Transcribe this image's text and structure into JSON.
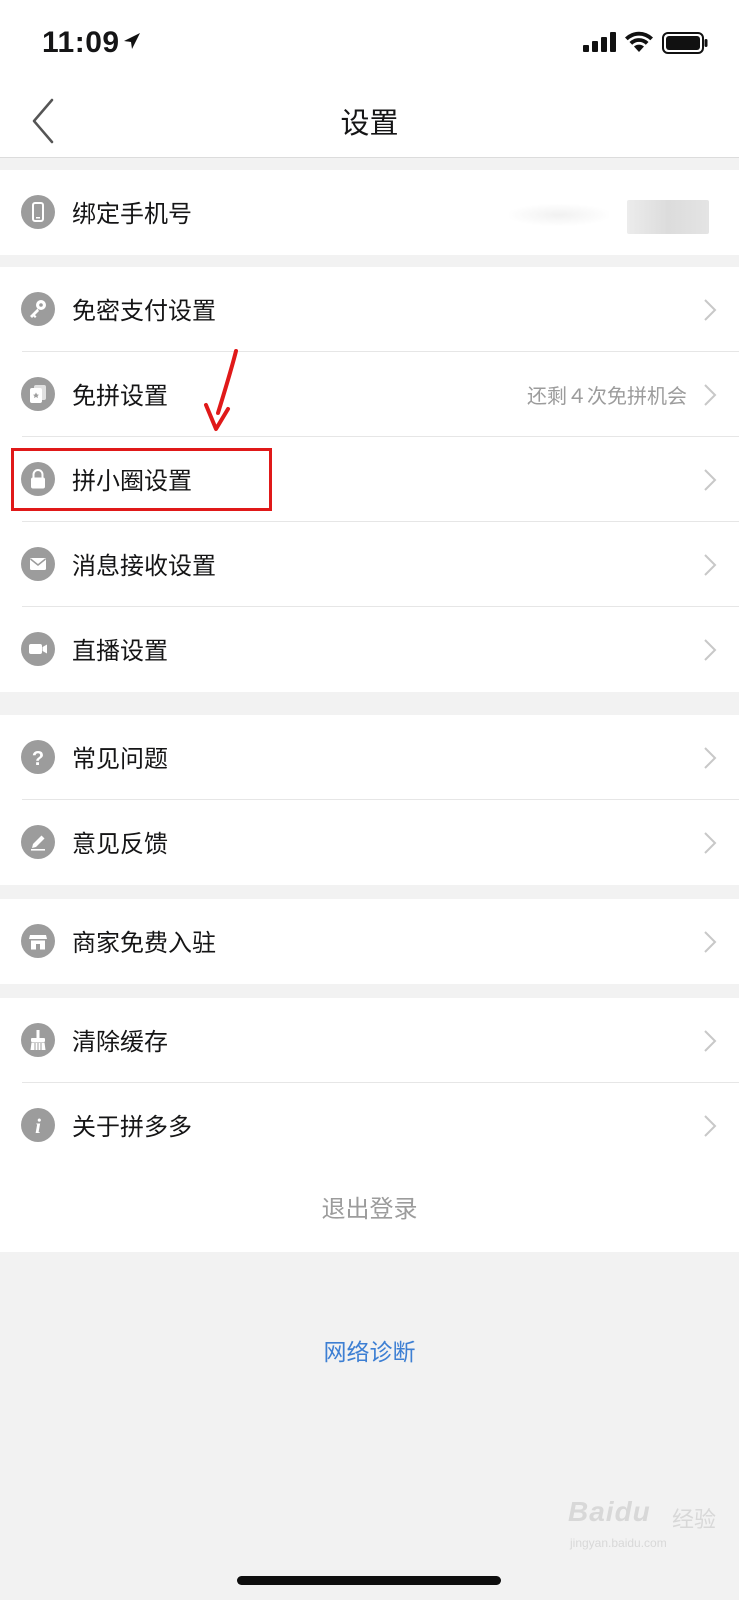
{
  "status_bar": {
    "time": "11:09"
  },
  "nav": {
    "title": "设置"
  },
  "groups": [
    {
      "items": [
        {
          "icon": "phone-icon",
          "label": "绑定手机号",
          "value": ""
        }
      ]
    },
    {
      "items": [
        {
          "icon": "key-icon",
          "label": "免密支付设置",
          "value": ""
        },
        {
          "icon": "cards-icon",
          "label": "免拼设置",
          "value": "还剩４次免拼机会"
        },
        {
          "icon": "lock-icon",
          "label": "拼小圈设置",
          "value": ""
        },
        {
          "icon": "mail-icon",
          "label": "消息接收设置",
          "value": ""
        },
        {
          "icon": "video-camera-icon",
          "label": "直播设置",
          "value": ""
        }
      ]
    },
    {
      "items": [
        {
          "icon": "question-icon",
          "label": "常见问题",
          "value": ""
        },
        {
          "icon": "pencil-icon",
          "label": "意见反馈",
          "value": ""
        }
      ]
    },
    {
      "items": [
        {
          "icon": "store-icon",
          "label": "商家免费入驻",
          "value": ""
        }
      ]
    },
    {
      "items": [
        {
          "icon": "broom-icon",
          "label": "清除缓存",
          "value": ""
        },
        {
          "icon": "info-icon",
          "label": "关于拼多多",
          "value": ""
        }
      ]
    }
  ],
  "logout": {
    "label": "退出登录"
  },
  "network_diagnosis": {
    "label": "网络诊断"
  },
  "watermark": {
    "brand": "Baidu",
    "brand_cn": "经验",
    "url": "jingyan.baidu.com"
  },
  "colors": {
    "background": "#f2f2f2",
    "icon_gray": "#9c9c9c",
    "link_blue": "#3d7fd3",
    "annotation_red": "#e01919"
  }
}
